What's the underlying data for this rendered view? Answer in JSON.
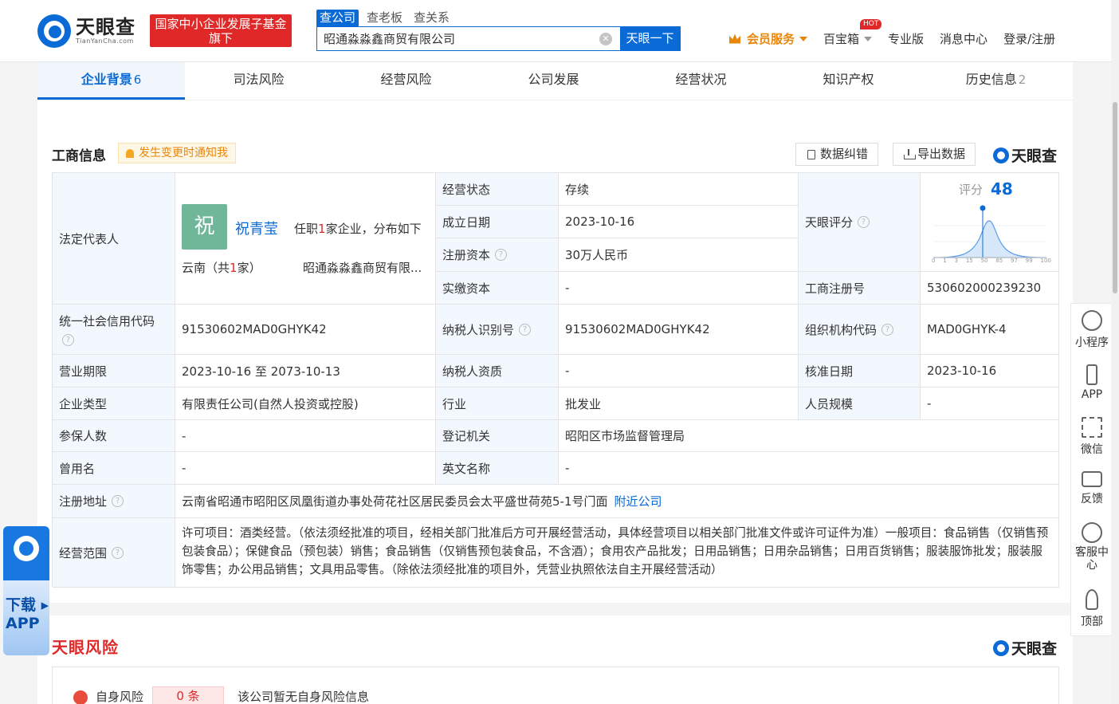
{
  "header": {
    "logo_cn": "天眼查",
    "logo_en": "TianYanCha.com",
    "banner_text": "国家中小企业发展子基金旗下",
    "search_tabs": [
      "查公司",
      "查老板",
      "查关系"
    ],
    "search_value": "昭通淼淼鑫商贸有限公司",
    "search_button": "天眼一下",
    "nav": {
      "vip": "会员服务",
      "baibao": "百宝箱",
      "hot": "HOT",
      "pro": "专业版",
      "msg": "消息中心",
      "login": "登录/注册"
    }
  },
  "tabs": [
    {
      "label": "企业背景",
      "count": "6"
    },
    {
      "label": "司法风险",
      "count": ""
    },
    {
      "label": "经营风险",
      "count": ""
    },
    {
      "label": "公司发展",
      "count": ""
    },
    {
      "label": "经营状况",
      "count": ""
    },
    {
      "label": "知识产权",
      "count": ""
    },
    {
      "label": "历史信息",
      "count": "2"
    }
  ],
  "business": {
    "title": "工商信息",
    "notify": "发生变更时通知我",
    "correct_btn": "数据纠错",
    "export_btn": "导出数据",
    "brand": "天眼查",
    "legal_rep_label": "法定代表人",
    "avatar_char": "祝",
    "legal_rep_name": "祝青莹",
    "legal_rep_desc_pre": "任职",
    "legal_rep_desc_num": "1",
    "legal_rep_desc_post": "家企业，分布如下",
    "region_pre": "云南（共",
    "region_num": "1",
    "region_post": "家）",
    "region_company": "昭通淼淼鑫商贸有限...",
    "status_label": "经营状态",
    "status": "存续",
    "found_label": "成立日期",
    "found_date": "2023-10-16",
    "capital_label": "注册资本",
    "capital": "30万人民币",
    "paid_label": "实缴资本",
    "paid": "-",
    "score_label": "天眼评分",
    "score_title": "评分",
    "score": "48",
    "score_ticks": [
      "0",
      "1",
      "3",
      "15",
      "50",
      "85",
      "97",
      "99",
      "100"
    ],
    "regno_label": "工商注册号",
    "regno": "530602000239230",
    "credit_label": "统一社会信用代码",
    "credit": "91530602MAD0GHYK42",
    "taxid_label": "纳税人识别号",
    "taxid": "91530602MAD0GHYK42",
    "org_label": "组织机构代码",
    "org": "MAD0GHYK-4",
    "term_label": "营业期限",
    "term": "2023-10-16 至 2073-10-13",
    "taxq_label": "纳税人资质",
    "taxq": "-",
    "approve_label": "核准日期",
    "approve": "2023-10-16",
    "type_label": "企业类型",
    "type": "有限责任公司(自然人投资或控股)",
    "industry_label": "行业",
    "industry": "批发业",
    "staff_label": "人员规模",
    "staff": "-",
    "insured_label": "参保人数",
    "insured": "-",
    "authority_label": "登记机关",
    "authority": "昭阳区市场监督管理局",
    "former_label": "曾用名",
    "former": "-",
    "en_label": "英文名称",
    "en": "-",
    "addr_label": "注册地址",
    "addr": "云南省昭通市昭阳区凤凰街道办事处荷花社区居民委员会太平盛世荷苑5-1号门面",
    "nearby": "附近公司",
    "scope_label": "经营范围",
    "scope": "许可项目：酒类经营。（依法须经批准的项目，经相关部门批准后方可开展经营活动，具体经营项目以相关部门批准文件或许可证件为准）一般项目：食品销售（仅销售预包装食品）；保健食品（预包装）销售；食品销售（仅销售预包装食品，不含酒）；食用农产品批发；日用品销售；日用杂品销售；日用百货销售；服装服饰批发；服装服饰零售；办公用品销售；文具用品零售。（除依法须经批准的项目外，凭营业执照依法自主开展经营活动）"
  },
  "side": [
    "小程序",
    "APP",
    "微信",
    "反馈",
    "客服中心",
    "顶部"
  ],
  "download": {
    "line1": "下载",
    "line2": "APP"
  },
  "risk": {
    "title": "天眼风险",
    "brand": "天眼查",
    "self_label": "自身风险",
    "self_count": "0 条",
    "self_desc": "该公司暂无自身风险信息"
  }
}
